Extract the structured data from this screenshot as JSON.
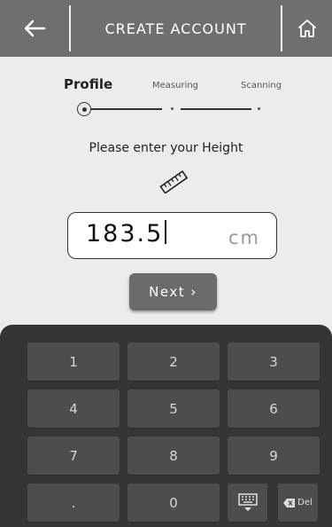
{
  "header": {
    "title": "CREATE ACCOUNT",
    "back_icon": "back-arrow-icon",
    "home_icon": "home-icon"
  },
  "steps": [
    {
      "label": "Profile",
      "active": true
    },
    {
      "label": "Measuring",
      "active": false
    },
    {
      "label": "Scanning",
      "active": false
    }
  ],
  "prompt": "Please enter your Height",
  "prompt_icon": "ruler-icon",
  "height": {
    "value": "183.5",
    "unit": "cm"
  },
  "next_label": "Next ›",
  "keypad": {
    "keys": [
      "1",
      "2",
      "3",
      "4",
      "5",
      "6",
      "7",
      "8",
      "9",
      ".",
      "0"
    ],
    "hide_icon": "keyboard-hide-icon",
    "delete_label": "Del",
    "delete_icon": "backspace-icon"
  },
  "colors": {
    "header": "#6f6f6f",
    "background": "#ececec",
    "keyboard": "#353535",
    "key": "#4d4d4d",
    "button": "#6b6b6b"
  }
}
